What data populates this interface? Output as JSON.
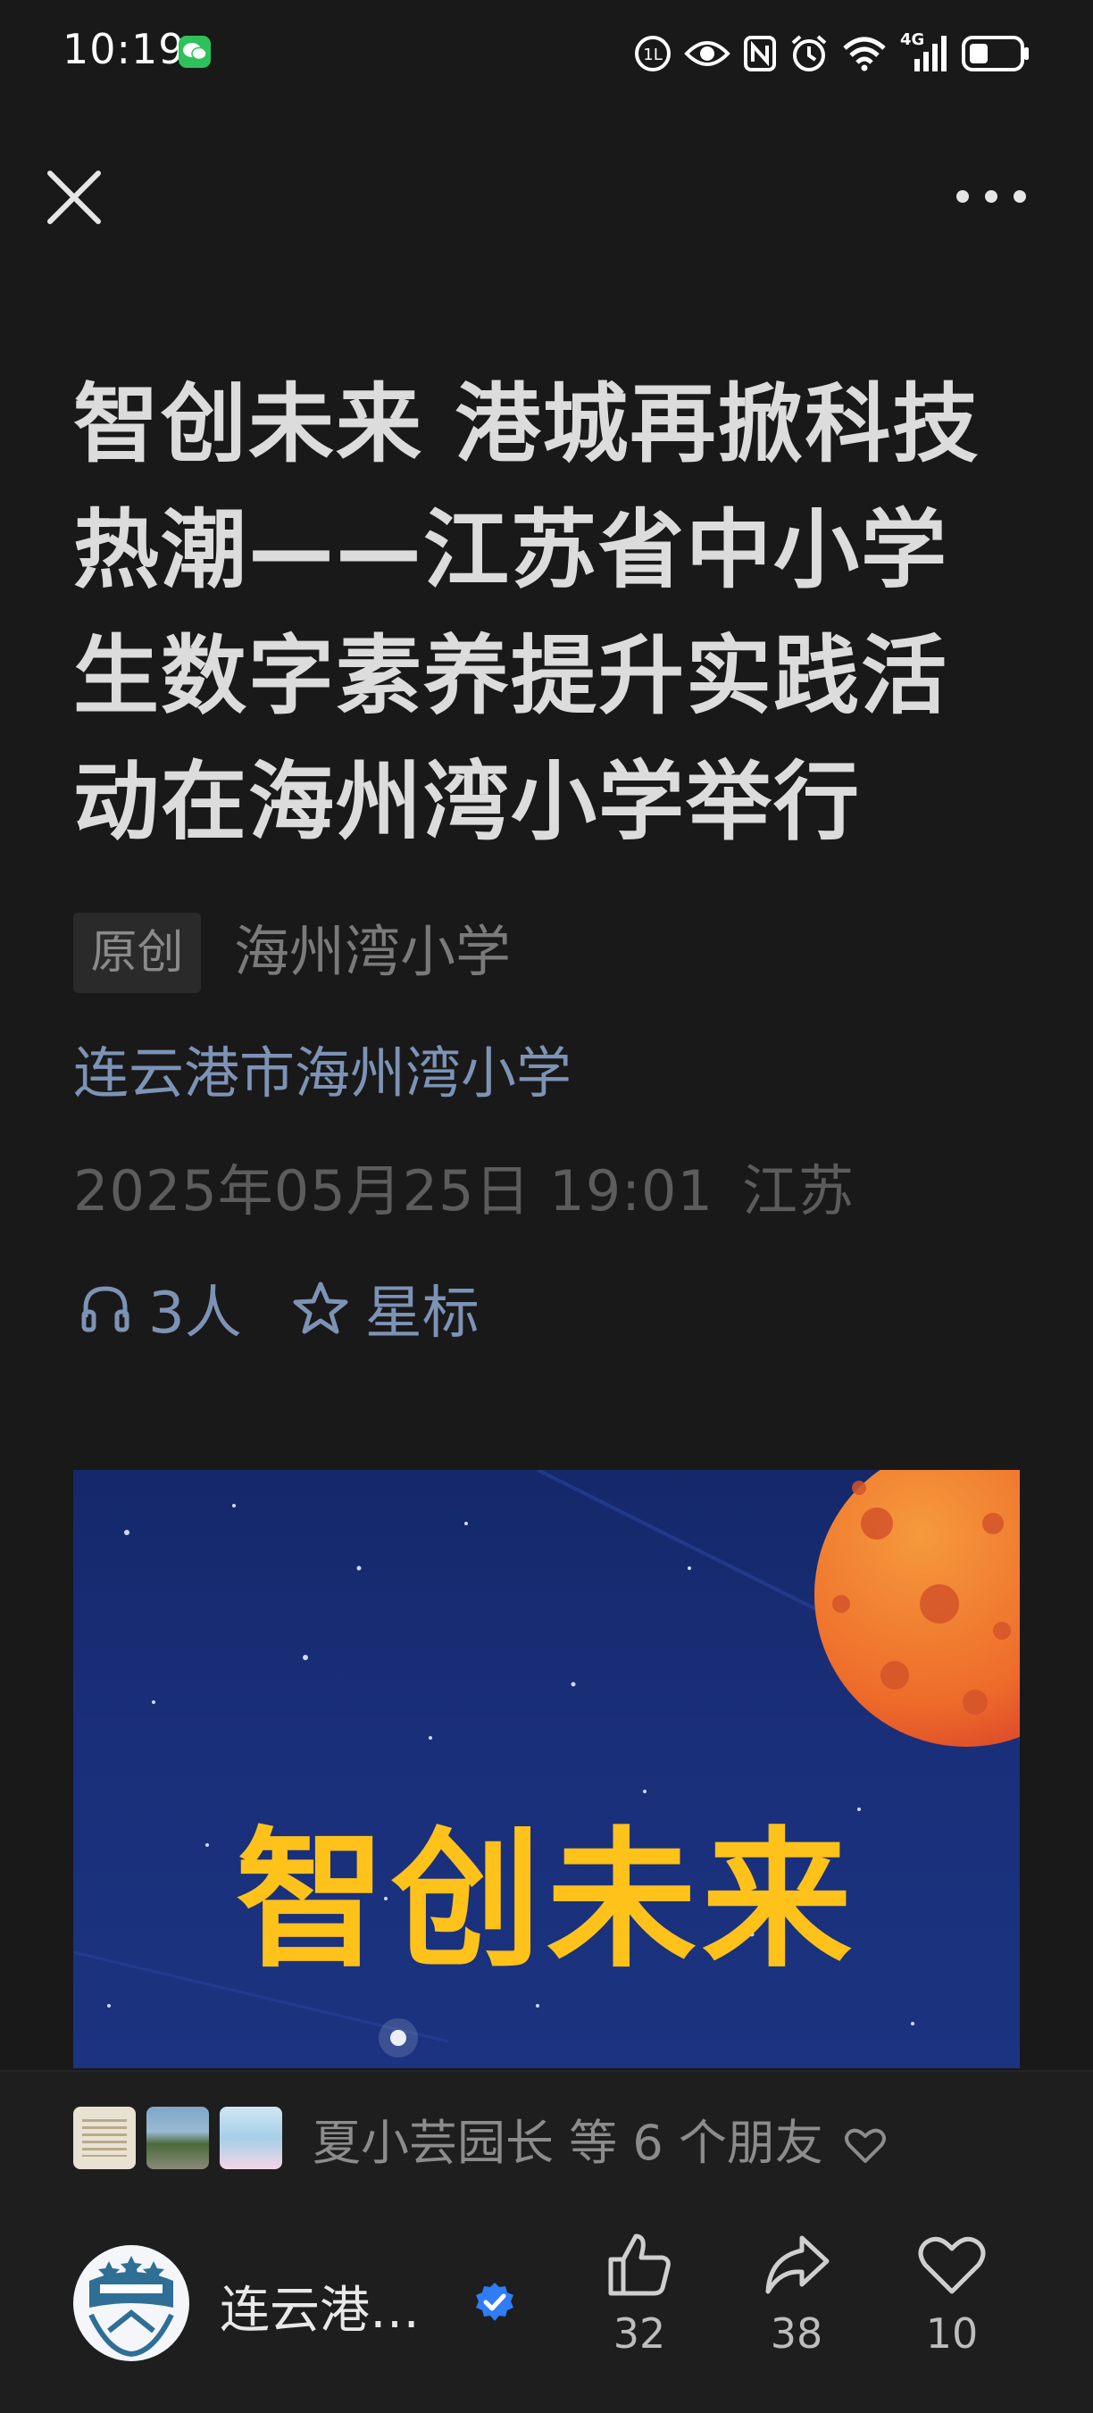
{
  "status_bar": {
    "time": "10:19",
    "network": "4G"
  },
  "article": {
    "title": "智创未来 港城再掀科技热潮——江苏省中小学生数字素养提升实践活动在海州湾小学举行",
    "original_badge": "原创",
    "author": "海州湾小学",
    "account": "连云港市海州湾小学",
    "publish_date": "2025年05月25日 19:01",
    "region": "江苏",
    "listeners": "3人",
    "star_label": "星标",
    "cover_title": "智创未来"
  },
  "bottom_bar": {
    "friends_text": "夏小芸园长 等 6 个朋友",
    "account_short": "连云港…",
    "likes": "32",
    "shares": "38",
    "favorites": "10"
  },
  "colors": {
    "background": "#191919",
    "link_blue": "#7d93b6",
    "cover_title_yellow": "#ffc21a",
    "verified_blue": "#2f7cf6"
  }
}
